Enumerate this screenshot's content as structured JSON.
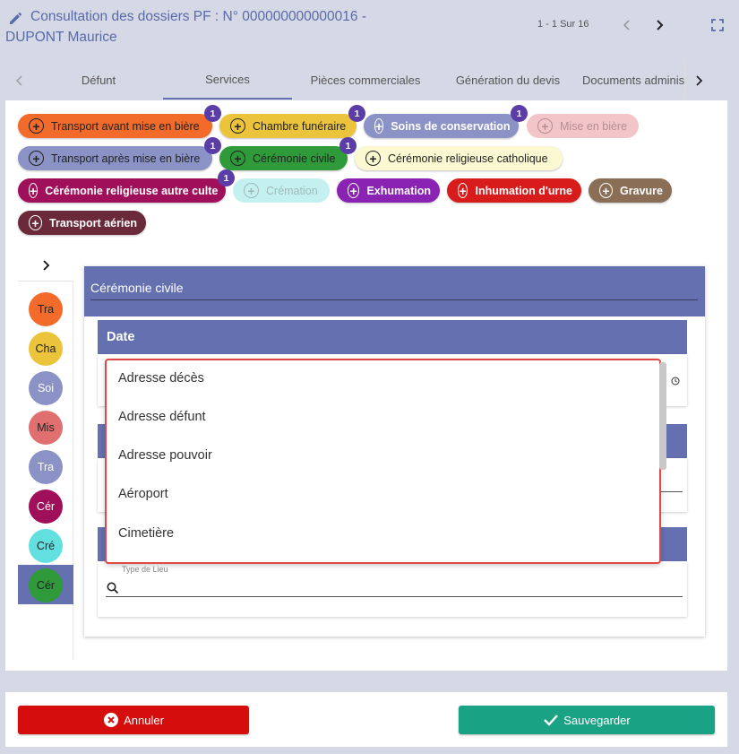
{
  "header": {
    "title_line1": "Consultation des dossiers PF : N° 000000000000016 -",
    "title_line2": "DUPONT Maurice",
    "pager": "1 - 1 Sur 16"
  },
  "tabs": [
    {
      "label": "Défunt"
    },
    {
      "label": "Services"
    },
    {
      "label": "Pièces commerciales"
    },
    {
      "label": "Génération du devis"
    },
    {
      "label": "Documents adminis"
    }
  ],
  "chips": [
    {
      "label": "Transport avant mise en bière",
      "badge": "1",
      "bg": "#f26b2b"
    },
    {
      "label": "Chambre funéraire",
      "badge": "1",
      "bg": "#ebc43c"
    },
    {
      "label": "Soins de conservation",
      "badge": "1",
      "bg": "#8b93c6"
    },
    {
      "label": "Mise en bière",
      "badge": "",
      "bg": "#f2c5c8"
    },
    {
      "label": "Transport après mise en bière",
      "badge": "1",
      "bg": "#8b93c6"
    },
    {
      "label": "Cérémonie civile",
      "badge": "1",
      "bg": "#2e9a3a"
    },
    {
      "label": "Cérémonie religieuse catholique",
      "badge": "",
      "bg": "#fbf8d2"
    },
    {
      "label": "Cérémonie religieuse autre culte",
      "badge": "1",
      "bg": "#a0105a"
    },
    {
      "label": "Crémation",
      "badge": "",
      "bg": "#c4f0f0"
    },
    {
      "label": "Exhumation",
      "badge": "",
      "bg": "#8a22b4"
    },
    {
      "label": "Inhumation d'urne",
      "badge": "",
      "bg": "#d81c1c"
    },
    {
      "label": "Gravure",
      "badge": "",
      "bg": "#8a6e55"
    },
    {
      "label": "Transport aérien",
      "badge": "",
      "bg": "#6b2a3a"
    }
  ],
  "sidebar": {
    "items": [
      {
        "label": "Tra",
        "bg": "#f26b2b"
      },
      {
        "label": "Cha",
        "bg": "#ebc43c"
      },
      {
        "label": "Soi",
        "bg": "#8b93c6"
      },
      {
        "label": "Mis",
        "bg": "#e07070"
      },
      {
        "label": "Tra",
        "bg": "#8b93c6"
      },
      {
        "label": "Cér",
        "bg": "#a0105a"
      },
      {
        "label": "Cré",
        "bg": "#62dfdf"
      },
      {
        "label": "Cér",
        "bg": "#2e9a3a"
      }
    ]
  },
  "content": {
    "section_title": "Cérémonie civile",
    "date_label": "Date",
    "lieu_field_label": "Type de Lieu"
  },
  "dropdown": {
    "options": [
      "Adresse décès",
      "Adresse défunt",
      "Adresse pouvoir",
      "Aéroport",
      "Cimetière"
    ]
  },
  "footer": {
    "cancel_label": "Annuler",
    "save_label": "Sauvegarder",
    "cancel_color": "#d50d0d",
    "save_color": "#19a384"
  }
}
